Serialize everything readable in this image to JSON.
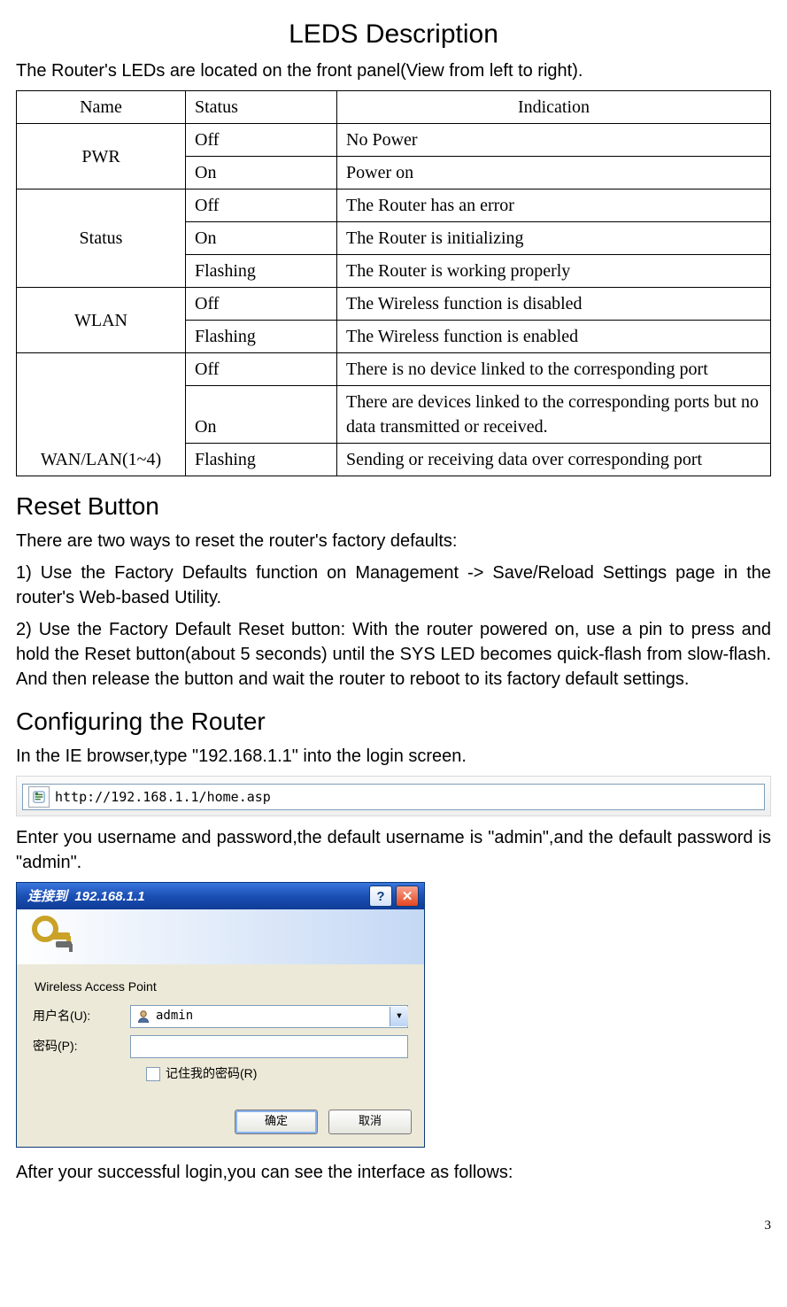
{
  "page_number": "3",
  "leds": {
    "heading": "LEDS Description",
    "intro": "The Router's LEDs are located on the front panel(View from left to right).",
    "headers": {
      "name": "Name",
      "status": "Status",
      "indication": "Indication"
    },
    "groups": [
      {
        "name": "PWR",
        "rows": [
          {
            "status": "Off",
            "indication": "No Power"
          },
          {
            "status": "On",
            "indication": "Power on"
          }
        ]
      },
      {
        "name": "Status",
        "rows": [
          {
            "status": "Off",
            "indication": "The Router has an error"
          },
          {
            "status": "On",
            "indication": "The Router is initializing"
          },
          {
            "status": "Flashing",
            "indication": "The Router is working properly"
          }
        ]
      },
      {
        "name": "WLAN",
        "rows": [
          {
            "status": "Off",
            "indication": "The Wireless function is disabled"
          },
          {
            "status": "Flashing",
            "indication": "The Wireless function is enabled"
          }
        ]
      },
      {
        "name": "WAN/LAN(1~4)",
        "rows": [
          {
            "status": "Off",
            "indication": "There is no device linked to the corresponding port"
          },
          {
            "status": "On",
            "indication": "There are devices linked to the corresponding ports but no data transmitted or received."
          },
          {
            "status": "Flashing",
            "indication": "Sending or receiving data over corresponding port"
          }
        ]
      }
    ]
  },
  "reset": {
    "heading": "Reset Button",
    "p1": "There are two ways to reset the router's factory defaults:",
    "p2": "1) Use the Factory Defaults function on Management -> Save/Reload Settings page in the router's Web-based Utility.",
    "p3": "2) Use the Factory Default Reset button: With the router powered on, use a pin to press and hold the Reset button(about 5 seconds) until the SYS LED becomes quick-flash from slow-flash. And then release the button and wait the router to reboot to its factory default settings."
  },
  "config": {
    "heading": "Configuring the Router",
    "p1": "In the IE browser,type \"192.168.1.1\" into the login screen.",
    "addressbar_url": "http://192.168.1.1/home.asp",
    "p2": "Enter you username and password,the default username is \"admin\",and the default password is \"admin\".",
    "p3": "After your successful login,you can see the interface as follows:"
  },
  "dialog": {
    "title": "连接到  192.168.1.1",
    "server": "Wireless Access Point",
    "username_label": "用户名(U):",
    "password_label": "密码(P):",
    "username_value": "admin",
    "remember_label": "记住我的密码(R)",
    "ok": "确定",
    "cancel": "取消"
  },
  "icons": {
    "help": "?",
    "close": "✕",
    "dropdown": "▾"
  }
}
